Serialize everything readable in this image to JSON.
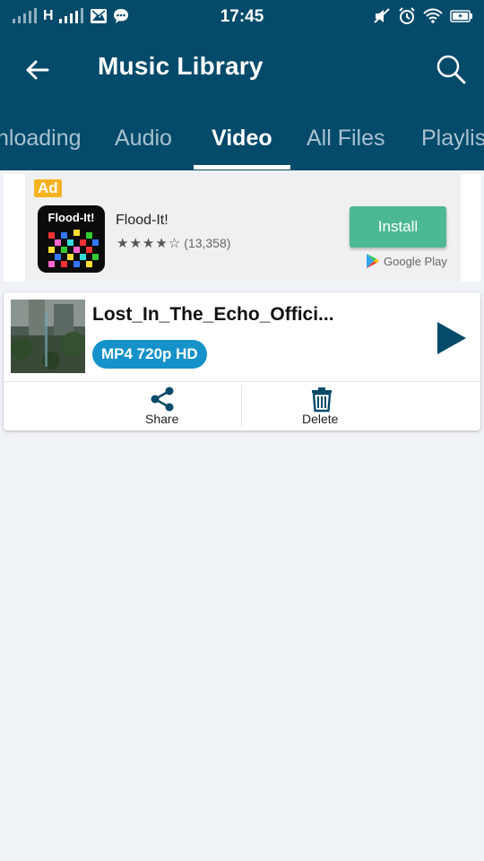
{
  "status_bar": {
    "network": "H",
    "time": "17:45"
  },
  "app_bar": {
    "title": "Music Library"
  },
  "tabs": [
    {
      "label": "nloading"
    },
    {
      "label": "Audio"
    },
    {
      "label": "Video"
    },
    {
      "label": "All Files"
    },
    {
      "label": "Playlis"
    }
  ],
  "ad": {
    "badge": "Ad",
    "icon_text": "Flood-It!",
    "app_name": "Flood-It!",
    "stars": "★★★★☆",
    "rating_count": "(13,358)",
    "install_label": "Install",
    "store_label": "Google Play"
  },
  "video_item": {
    "title": "Lost_In_The_Echo_Offici...",
    "format_badge": "MP4 720p HD",
    "share_label": "Share",
    "delete_label": "Delete"
  },
  "colors": {
    "primary": "#044a6a",
    "badge": "#1592c9",
    "install": "#4db992",
    "ad_badge": "#f6b321",
    "background": "#eff2f6"
  }
}
